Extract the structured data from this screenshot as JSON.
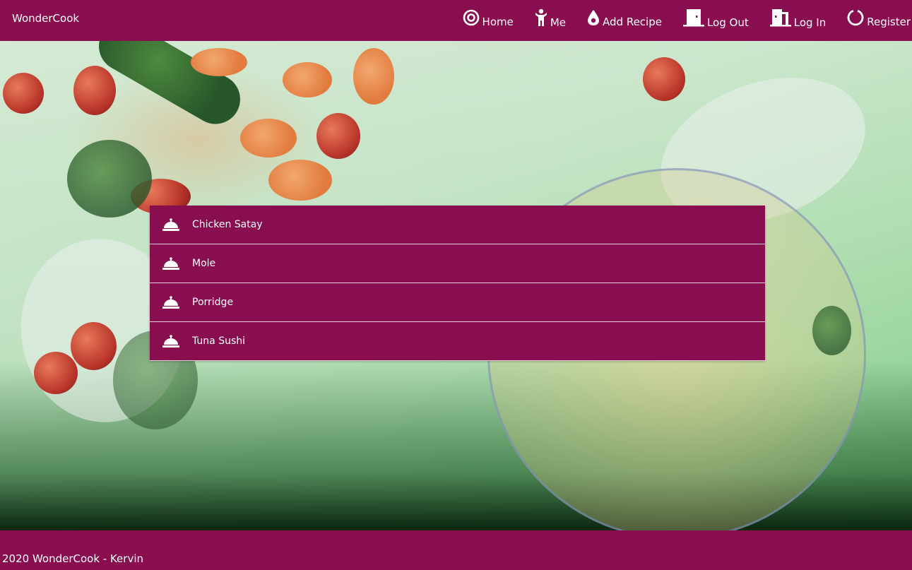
{
  "navbar": {
    "brand": "WonderCook",
    "links": [
      {
        "label": "Home",
        "icon": "target-icon"
      },
      {
        "label": "Me",
        "icon": "person-icon"
      },
      {
        "label": "Add Recipe",
        "icon": "drop-icon"
      },
      {
        "label": "Log Out",
        "icon": "door-icon"
      },
      {
        "label": "Log In",
        "icon": "door-open-icon"
      },
      {
        "label": "Register",
        "icon": "ring-icon"
      }
    ]
  },
  "recipes": [
    {
      "name": "Chicken Satay",
      "icon": "service-bell-icon"
    },
    {
      "name": "Mole",
      "icon": "service-bell-icon"
    },
    {
      "name": "Porridge",
      "icon": "service-bell-icon"
    },
    {
      "name": "Tuna Sushi",
      "icon": "service-bell-icon"
    }
  ],
  "footer": {
    "text": "2020 WonderCook - Kervin"
  },
  "colors": {
    "primary": "#880e4f",
    "text": "#ffffff"
  }
}
